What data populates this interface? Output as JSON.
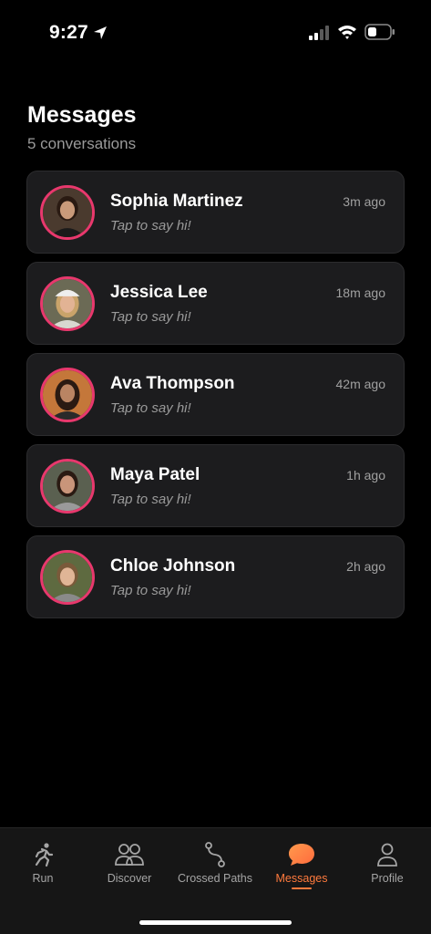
{
  "status_bar": {
    "time": "9:27"
  },
  "header": {
    "title": "Messages",
    "subtitle": "5 conversations"
  },
  "conversations": [
    {
      "name": "Sophia Martinez",
      "time": "3m ago",
      "preview": "Tap to say hi!"
    },
    {
      "name": "Jessica Lee",
      "time": "18m ago",
      "preview": "Tap to say hi!"
    },
    {
      "name": "Ava Thompson",
      "time": "42m ago",
      "preview": "Tap to say hi!"
    },
    {
      "name": "Maya Patel",
      "time": "1h ago",
      "preview": "Tap to say hi!"
    },
    {
      "name": "Chloe Johnson",
      "time": "2h ago",
      "preview": "Tap to say hi!"
    }
  ],
  "tabs": [
    {
      "label": "Run",
      "icon": "runner-icon"
    },
    {
      "label": "Discover",
      "icon": "people-icon"
    },
    {
      "label": "Crossed Paths",
      "icon": "route-icon"
    },
    {
      "label": "Messages",
      "icon": "chat-bubble-icon",
      "active": true
    },
    {
      "label": "Profile",
      "icon": "person-icon"
    }
  ],
  "colors": {
    "accent": "#ff7a3d",
    "avatar_ring": "#e8386d",
    "card_bg": "#1c1c1e"
  }
}
